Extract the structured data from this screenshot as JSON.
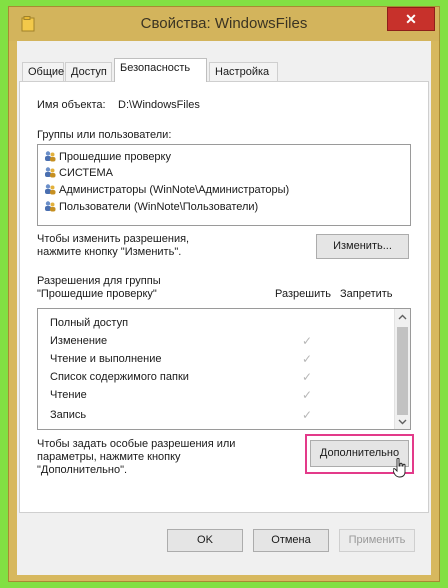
{
  "window": {
    "title": "Свойства: WindowsFiles",
    "close_label": "✕"
  },
  "tabs": [
    {
      "label": "Общие"
    },
    {
      "label": "Доступ"
    },
    {
      "label": "Безопасность"
    },
    {
      "label": "Настройка"
    }
  ],
  "object": {
    "label": "Имя объекта:",
    "value": "D:\\WindowsFiles"
  },
  "groups": {
    "label": "Группы или пользователи:",
    "items": [
      {
        "label": "Прошедшие проверку",
        "icon": "users-icon"
      },
      {
        "label": "СИСТЕМА",
        "icon": "users-icon"
      },
      {
        "label": "Администраторы (WinNote\\Администраторы)",
        "icon": "users-icon"
      },
      {
        "label": "Пользователи (WinNote\\Пользователи)",
        "icon": "users-icon"
      }
    ]
  },
  "change": {
    "text_line1": "Чтобы изменить разрешения,",
    "text_line2": "нажмите кнопку \"Изменить\".",
    "button": "Изменить..."
  },
  "permissions": {
    "label_line1": "Разрешения для группы",
    "label_line2": "\"Прошедшие проверку\"",
    "allow_header": "Разрешить",
    "deny_header": "Запретить",
    "items": [
      {
        "label": "Полный доступ",
        "allow": ""
      },
      {
        "label": "Изменение",
        "allow": "✓"
      },
      {
        "label": "Чтение и выполнение",
        "allow": "✓"
      },
      {
        "label": "Список содержимого папки",
        "allow": "✓"
      },
      {
        "label": "Чтение",
        "allow": "✓"
      },
      {
        "label": "Запись",
        "allow": "✓"
      }
    ]
  },
  "advanced": {
    "text_line1": "Чтобы задать особые разрешения или",
    "text_line2": "параметры, нажмите кнопку",
    "text_line3": "\"Дополнительно\".",
    "button": "Дополнительно"
  },
  "footer": {
    "ok": "OK",
    "cancel": "Отмена",
    "apply": "Применить"
  },
  "colors": {
    "highlight": "#e33a8a",
    "titlebar": "#d3b45c",
    "background": "#82e043"
  }
}
